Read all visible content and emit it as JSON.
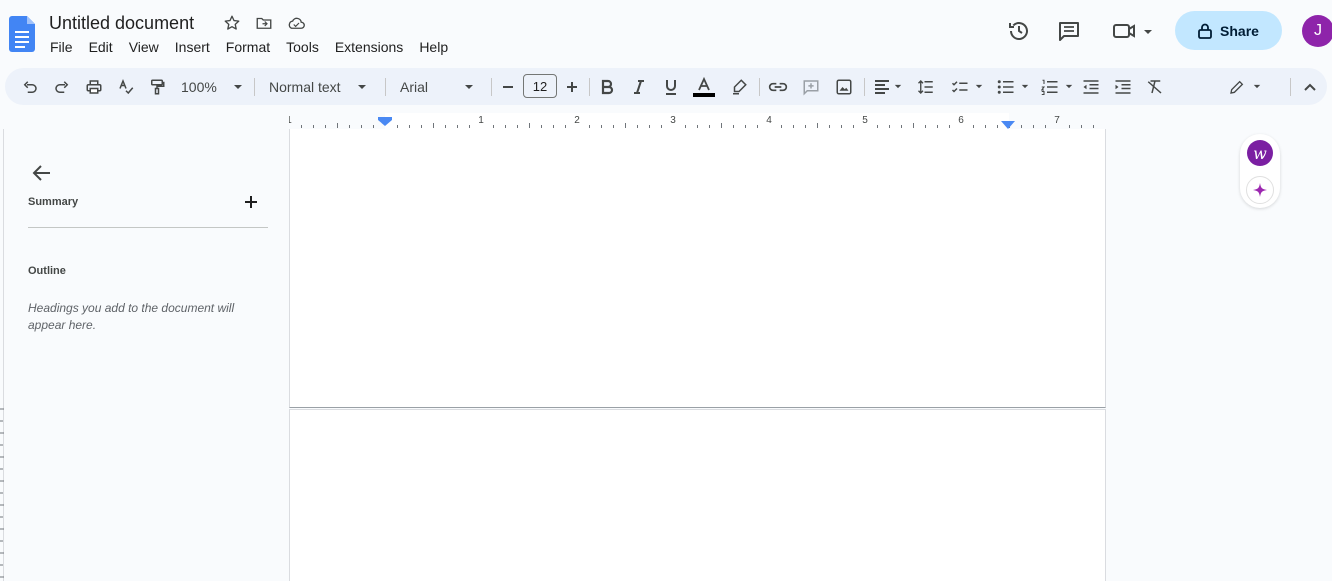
{
  "header": {
    "doc_title": "Untitled document",
    "menu": [
      "File",
      "Edit",
      "View",
      "Insert",
      "Format",
      "Tools",
      "Extensions",
      "Help"
    ],
    "share_label": "Share",
    "avatar_initial": "J"
  },
  "toolbar": {
    "zoom": "100%",
    "style": "Normal text",
    "font": "Arial",
    "font_size": "12"
  },
  "ruler": {
    "labels": [
      "1",
      "1",
      "2",
      "3",
      "4",
      "5",
      "6",
      "7"
    ]
  },
  "outline": {
    "summary_label": "Summary",
    "outline_label": "Outline",
    "hint": "Headings you add to the document will appear here."
  },
  "colors": {
    "accent": "#0b57d0",
    "share_bg": "#c2e7ff",
    "avatar": "#8e24aa",
    "toolbar_bg": "#edf2fa"
  }
}
